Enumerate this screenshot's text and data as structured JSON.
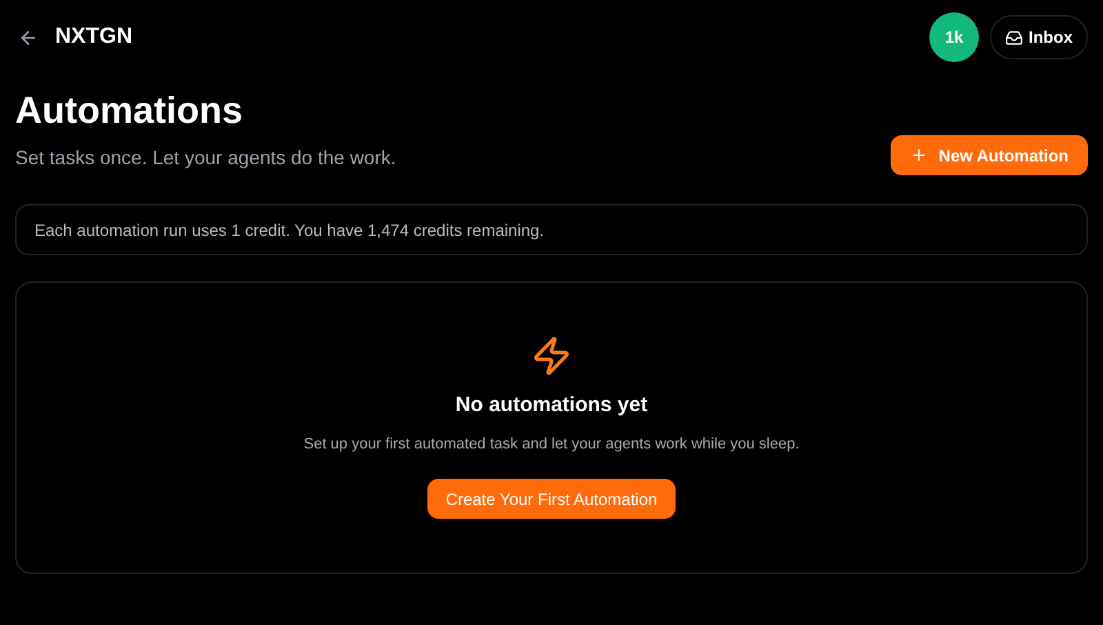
{
  "header": {
    "brand": "NXTGN",
    "credits_badge": "1k",
    "inbox_button": "Inbox"
  },
  "page": {
    "title": "Automations",
    "subtitle": "Set tasks once. Let your agents do the work.",
    "new_button": "New Automation"
  },
  "notice": "Each automation run uses 1 credit. You have 1,474 credits remaining.",
  "empty_state": {
    "title": "No automations yet",
    "description": "Set up your first automated task and let your agents work while you sleep.",
    "button": "Create Your First Automation"
  }
}
